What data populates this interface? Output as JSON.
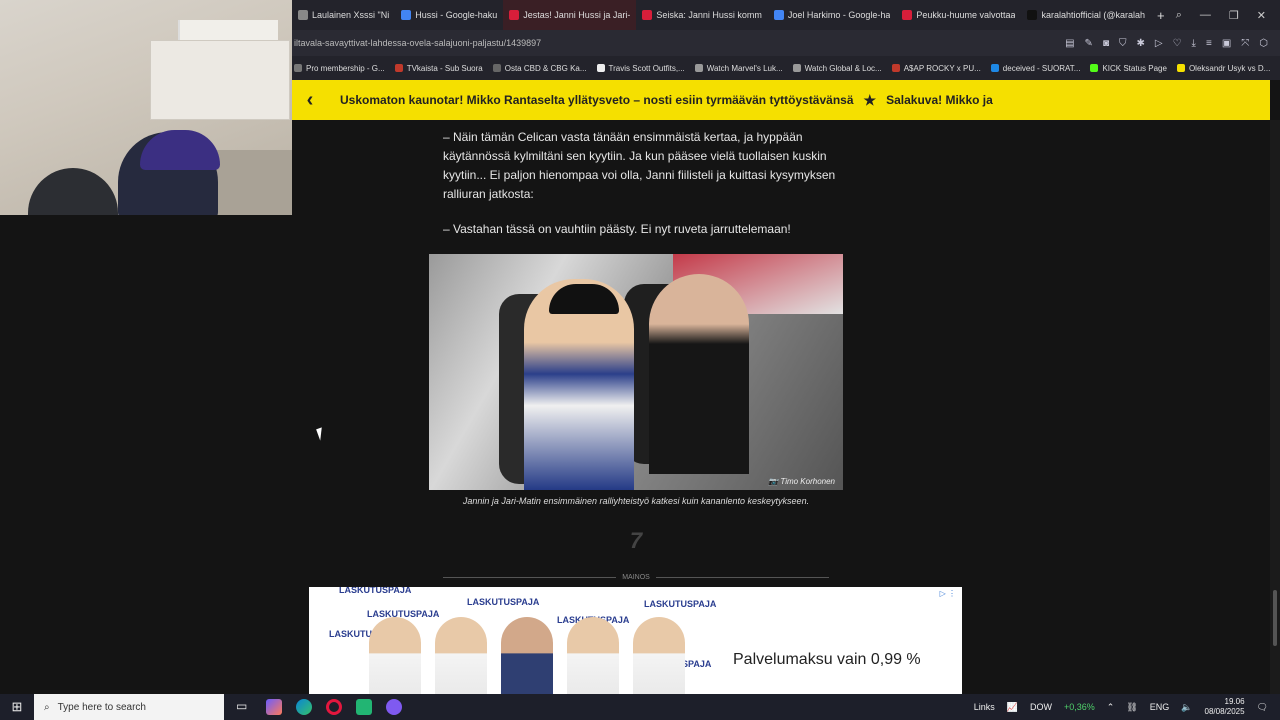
{
  "browser": {
    "tabs": [
      {
        "label": "Laulainen Xsssi \"Ni",
        "color": "#888888",
        "active": false
      },
      {
        "label": "Hussi - Google-haku",
        "color": "#4285f4",
        "active": false
      },
      {
        "label": "Jestas! Janni Hussi ja Jari-",
        "color": "#d81e3a",
        "active": true
      },
      {
        "label": "Seiska: Janni Hussi komm",
        "color": "#d81e3a",
        "active": false
      },
      {
        "label": "Joel Harkimo - Google-ha",
        "color": "#4285f4",
        "active": false
      },
      {
        "label": "Peukku-huume valvottaa",
        "color": "#d81e3a",
        "active": false
      },
      {
        "label": "karalahtiofficial (@karalah",
        "color": "#111111",
        "active": false
      }
    ],
    "url": "iltavala-savayttivat-lahdessa-ovela-salajuoni-paljastu/1439897",
    "bookmarks": [
      {
        "label": "Pro membership - G...",
        "color": "#777777"
      },
      {
        "label": "TVkaista - Sub Suora",
        "color": "#c0392b"
      },
      {
        "label": "Osta CBD & CBG Ka...",
        "color": "#666666"
      },
      {
        "label": "Travis Scott Outfits,...",
        "color": "#eeeeee"
      },
      {
        "label": "Watch Marvel's Luk...",
        "color": "#999999"
      },
      {
        "label": "Watch Global & Loc...",
        "color": "#999999"
      },
      {
        "label": "A$AP ROCKY x PU...",
        "color": "#c0392b"
      },
      {
        "label": "deceived - SUORAT...",
        "color": "#1e88e5"
      },
      {
        "label": "KICK Status Page",
        "color": "#53fc18"
      },
      {
        "label": "Oleksandr Usyk vs D...",
        "color": "#f5e000"
      }
    ]
  },
  "ticker": {
    "item1": "Uskomaton kaunotar! Mikko Rantaselta yllätysveto – nosti esiin tyrmäävän tyttöystävänsä",
    "item2": "Salakuva! Mikko ja"
  },
  "article": {
    "paragraph1": "– Näin tämän Celican vasta tänään ensimmäistä kertaa, ja hyppään käytännössä kylmiltäni sen kyytiin. Ja kun pääsee vielä tuollaisen kuskin kyytiin... Ei paljon hienompaa voi olla, Janni fiilisteli ja kuittasi kysymyksen ralliuran jatkosta:",
    "paragraph2": "– Vastahan tässä on vauhtiin päästy. Ei nyt ruveta jarruttelemaan!",
    "photo_credit": "Timo Korhonen",
    "caption": "Jannin ja Jari-Matin ensimmäinen ralliyhteistyö katkesi kuin kananlento keskeytykseen.",
    "logo": "7",
    "ad_label": "MAINOS"
  },
  "ad": {
    "brand": "LASKUTUSPAJA",
    "headline": "Palvelumaksu vain 0,99 %"
  },
  "taskbar": {
    "search_placeholder": "Type here to search",
    "links": "Links",
    "stock_name": "DOW",
    "stock_change": "+0,36%",
    "lang": "ENG",
    "time": "19.06",
    "date": "08/08/2025"
  }
}
